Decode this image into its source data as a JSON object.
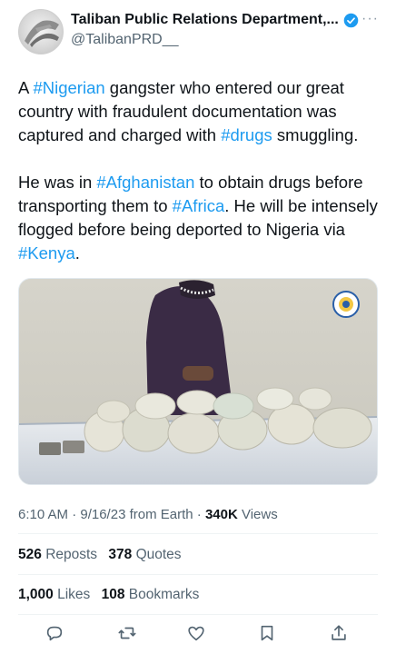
{
  "author": {
    "display_name": "Taliban Public Relations Department,...",
    "handle": "@TalibanPRD__",
    "more_label": "···"
  },
  "tweet": {
    "p1": [
      {
        "text": "A ",
        "tag": false
      },
      {
        "text": "#Nigerian",
        "tag": true
      },
      {
        "text": " gangster who entered our great country with fraudulent documentation was captured and charged with ",
        "tag": false
      },
      {
        "text": "#drugs",
        "tag": true
      },
      {
        "text": " smuggling.",
        "tag": false
      }
    ],
    "p2": [
      {
        "text": "He was in ",
        "tag": false
      },
      {
        "text": "#Afghanistan",
        "tag": true
      },
      {
        "text": " to obtain drugs before transporting them to ",
        "tag": false
      },
      {
        "text": "#Africa",
        "tag": true
      },
      {
        "text": ". He will be intensely flogged before being deported to Nigeria via ",
        "tag": false
      },
      {
        "text": "#Kenya",
        "tag": true
      },
      {
        "text": ".",
        "tag": false
      }
    ]
  },
  "meta": {
    "time": "6:10 AM · 9/16/23 from Earth · ",
    "views_count": "340K",
    "views_label": " Views"
  },
  "stats": {
    "reposts_count": "526",
    "reposts_label": "Reposts",
    "quotes_count": "378",
    "quotes_label": "Quotes",
    "likes_count": "1,000",
    "likes_label": "Likes",
    "bookmarks_count": "108",
    "bookmarks_label": "Bookmarks"
  },
  "colors": {
    "link": "#1d9bf0",
    "secondary_text": "#536471",
    "verified": "#1d9bf0"
  },
  "icons": [
    "reply-icon",
    "repost-icon",
    "like-icon",
    "bookmark-icon",
    "share-icon",
    "verified-badge-icon",
    "more-icon"
  ]
}
